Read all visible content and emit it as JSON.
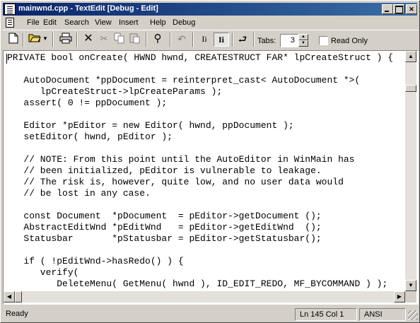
{
  "window": {
    "title": "mainwnd.cpp - TextEdit [Debug - Edit]"
  },
  "menu": {
    "items": [
      "File",
      "Edit",
      "Search",
      "View",
      "Insert",
      "Help",
      "Debug"
    ]
  },
  "toolbar": {
    "tabs_label": "Tabs:",
    "tabs_value": "3",
    "read_only_label": "Read Only",
    "word_wrap_label": "Ii",
    "proportional_label": "Ii"
  },
  "editor": {
    "lines": [
      "PRIVATE bool onCreate( HWND hwnd, CREATESTRUCT FAR* lpCreateStruct ) {",
      "",
      "   AutoDocument *ppDocument = reinterpret_cast< AutoDocument *>(",
      "      lpCreateStruct->lpCreateParams );",
      "   assert( 0 != ppDocument );",
      "",
      "   Editor *pEditor = new Editor( hwnd, ppDocument );",
      "   setEditor( hwnd, pEditor );",
      "",
      "   // NOTE: From this point until the AutoEditor in WinMain has",
      "   // been initialized, pEditor is vulnerable to leakage.",
      "   // The risk is, however, quite low, and no user data would",
      "   // be lost in any case.",
      "",
      "   const Document  *pDocument  = pEditor->getDocument ();",
      "   AbstractEditWnd *pEditWnd   = pEditor->getEditWnd  ();",
      "   Statusbar       *pStatusbar = pEditor->getStatusbar();",
      "",
      "   if ( !pEditWnd->hasRedo() ) {",
      "      verify(",
      "         DeleteMenu( GetMenu( hwnd ), ID_EDIT_REDO, MF_BYCOMMAND ) );"
    ]
  },
  "status": {
    "ready": "Ready",
    "position": "Ln 145  Col 1",
    "encoding": "ANSI"
  }
}
